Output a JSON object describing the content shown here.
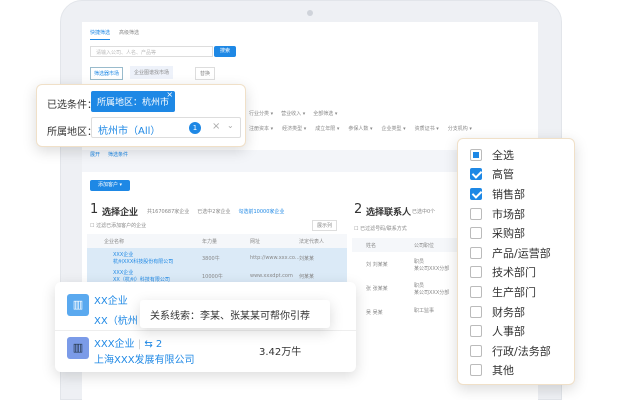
{
  "tabs": [
    "快捷筛选",
    "高级筛选"
  ],
  "search": {
    "placeholder": "请输入公司、人名、产品等",
    "button": "搜索"
  },
  "filter_buttons": [
    "筛选器市场",
    "企业图谱找市场",
    "替换"
  ],
  "filter_dropdowns_row1": [
    "行业分类",
    "营业收入",
    "所属地区",
    "全部筛选"
  ],
  "filter_dropdowns_row2": [
    "注册资本",
    "经济类型",
    "成立年限",
    "参保人数",
    "企业类型",
    "资质证书",
    "分支机构"
  ],
  "filter_links": [
    "展开",
    "筛选条件"
  ],
  "add_button": "添加客户",
  "section1": {
    "num": "1",
    "title": "选择企业",
    "count": "共1670687家企业",
    "selected": "已选中2家企业",
    "link": "勾选前10000家企业",
    "checkbox": "过滤已添加客户的企业",
    "display_btn": "展示列"
  },
  "table": {
    "headers": [
      "企业名称",
      "年力量",
      "网址",
      "法定代表人"
    ],
    "rows": [
      {
        "name": "XXX企业",
        "full": "杭州XXX科技股份有限公司",
        "value": "3800牛",
        "url": "http://www.xxx.co...",
        "person": "刘某某"
      },
      {
        "name": "XXX企业",
        "full": "XX（杭州）科技有限公司",
        "value": "10000牛",
        "url": "www.xxxdpt.com",
        "person": "何某某"
      }
    ]
  },
  "section2": {
    "num": "2",
    "title": "选择联系人",
    "selected": "已选中0个",
    "checkbox": "已过滤号码/联系方式",
    "headers": [
      "姓名",
      "公司职位"
    ],
    "rows": [
      {
        "avatar": "刘",
        "name": "刘某某",
        "role": "职员",
        "sub": "某公司XXX分部"
      },
      {
        "avatar": "张",
        "name": "张某某",
        "role": "职员",
        "sub": "某公司XXX分部"
      },
      {
        "avatar": "吴",
        "name": "吴某",
        "role": "职工监事",
        "sub": ""
      }
    ]
  },
  "popup_region": {
    "selected_label": "已选条件：",
    "tag": "所属地区：杭州市",
    "region_label": "所属地区：",
    "region_value": "杭州市（All）",
    "region_count": "1"
  },
  "checklist": [
    {
      "label": "全选",
      "state": "partial"
    },
    {
      "label": "高管",
      "state": "checked"
    },
    {
      "label": "销售部",
      "state": "checked"
    },
    {
      "label": "市场部",
      "state": "unchecked"
    },
    {
      "label": "采购部",
      "state": "unchecked"
    },
    {
      "label": "产品/运营部",
      "state": "unchecked"
    },
    {
      "label": "技术部门",
      "state": "unchecked"
    },
    {
      "label": "生产部门",
      "state": "unchecked"
    },
    {
      "label": "财务部",
      "state": "unchecked"
    },
    {
      "label": "人事部",
      "state": "unchecked"
    },
    {
      "label": "行政/法务部",
      "state": "unchecked"
    },
    {
      "label": "其他",
      "state": "unchecked"
    }
  ],
  "company_card": {
    "item1": {
      "name": "XX企业",
      "full": "XX（杭州"
    },
    "tooltip": "关系线索：李某、张某某可帮你引荐",
    "item2": {
      "name": "XXX企业",
      "links": "2",
      "full": "上海XXX发展有限公司",
      "value": "3.42万牛"
    }
  },
  "colors": {
    "accent": "#1e88e5",
    "icon": "#6f9cf0"
  }
}
